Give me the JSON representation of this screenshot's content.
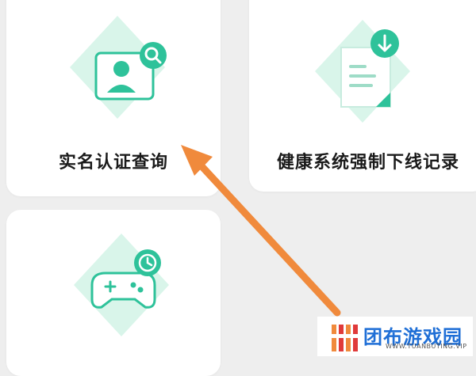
{
  "cards": [
    {
      "label": "实名认证查询",
      "icon": "id-card-search-icon"
    },
    {
      "label": "健康系统强制下线记录",
      "icon": "document-download-icon"
    },
    {
      "label": "",
      "icon": "gamepad-clock-icon"
    }
  ],
  "watermark": {
    "title": "团布游戏园",
    "url": "WWW.TUANBUTING.VIP"
  },
  "colors": {
    "accent_green": "#2ec29a",
    "light_green": "#c9f0e2",
    "arrow_orange": "#f08a3c",
    "watermark_blue": "#1f6fd6"
  }
}
